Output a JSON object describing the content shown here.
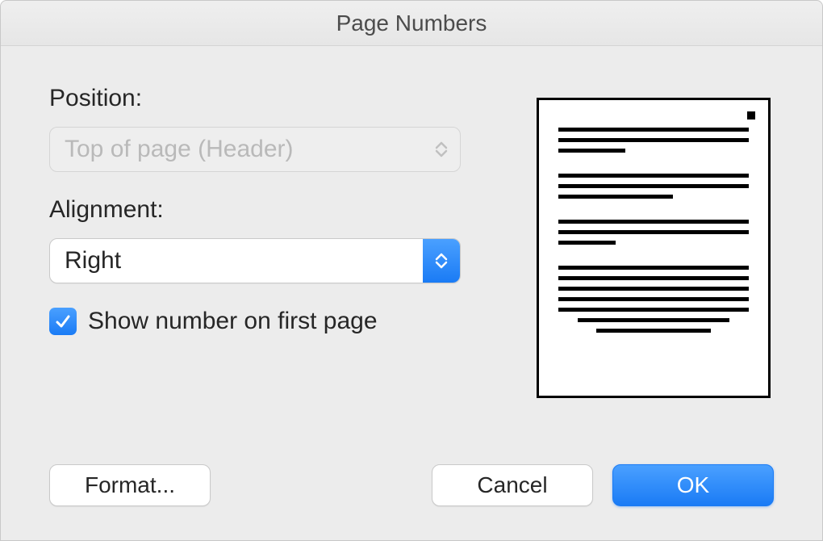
{
  "dialog": {
    "title": "Page Numbers",
    "position_label": "Position:",
    "position_value": "Top of page (Header)",
    "alignment_label": "Alignment:",
    "alignment_value": "Right",
    "checkbox_label": "Show number on first page",
    "checkbox_checked": true,
    "buttons": {
      "format": "Format...",
      "cancel": "Cancel",
      "ok": "OK"
    }
  }
}
